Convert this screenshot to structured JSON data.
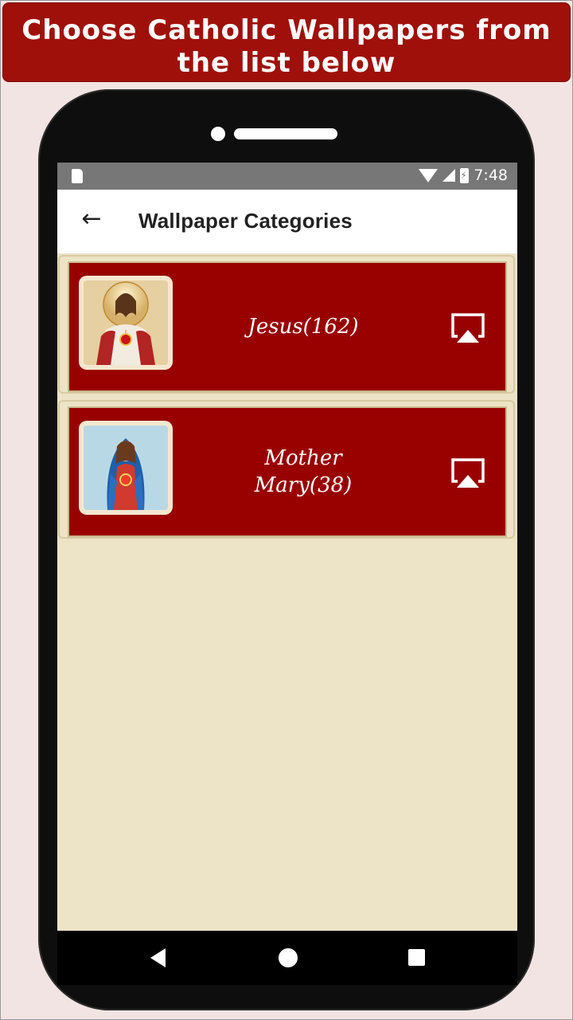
{
  "banner": {
    "text": "Choose Catholic Wallpapers from the list below"
  },
  "statusbar": {
    "time": "7:48",
    "icons": [
      "sd-card-icon",
      "wifi-icon",
      "signal-icon",
      "battery-icon"
    ]
  },
  "appbar": {
    "title": "Wallpaper Categories",
    "back_icon": "back-arrow-icon"
  },
  "categories": [
    {
      "label": "Jesus(162)",
      "thumb_icon": "jesus-thumbnail",
      "action_icon": "airplay-icon"
    },
    {
      "label": "Mother Mary(38)",
      "thumb_icon": "mary-thumbnail",
      "action_icon": "airplay-icon"
    }
  ],
  "navbar": {
    "icons": [
      "nav-back-icon",
      "nav-home-icon",
      "nav-recent-icon"
    ]
  },
  "colors": {
    "banner": "#a0100a",
    "card": "#990000",
    "background": "#ede3c6",
    "statusbar": "#777777"
  }
}
